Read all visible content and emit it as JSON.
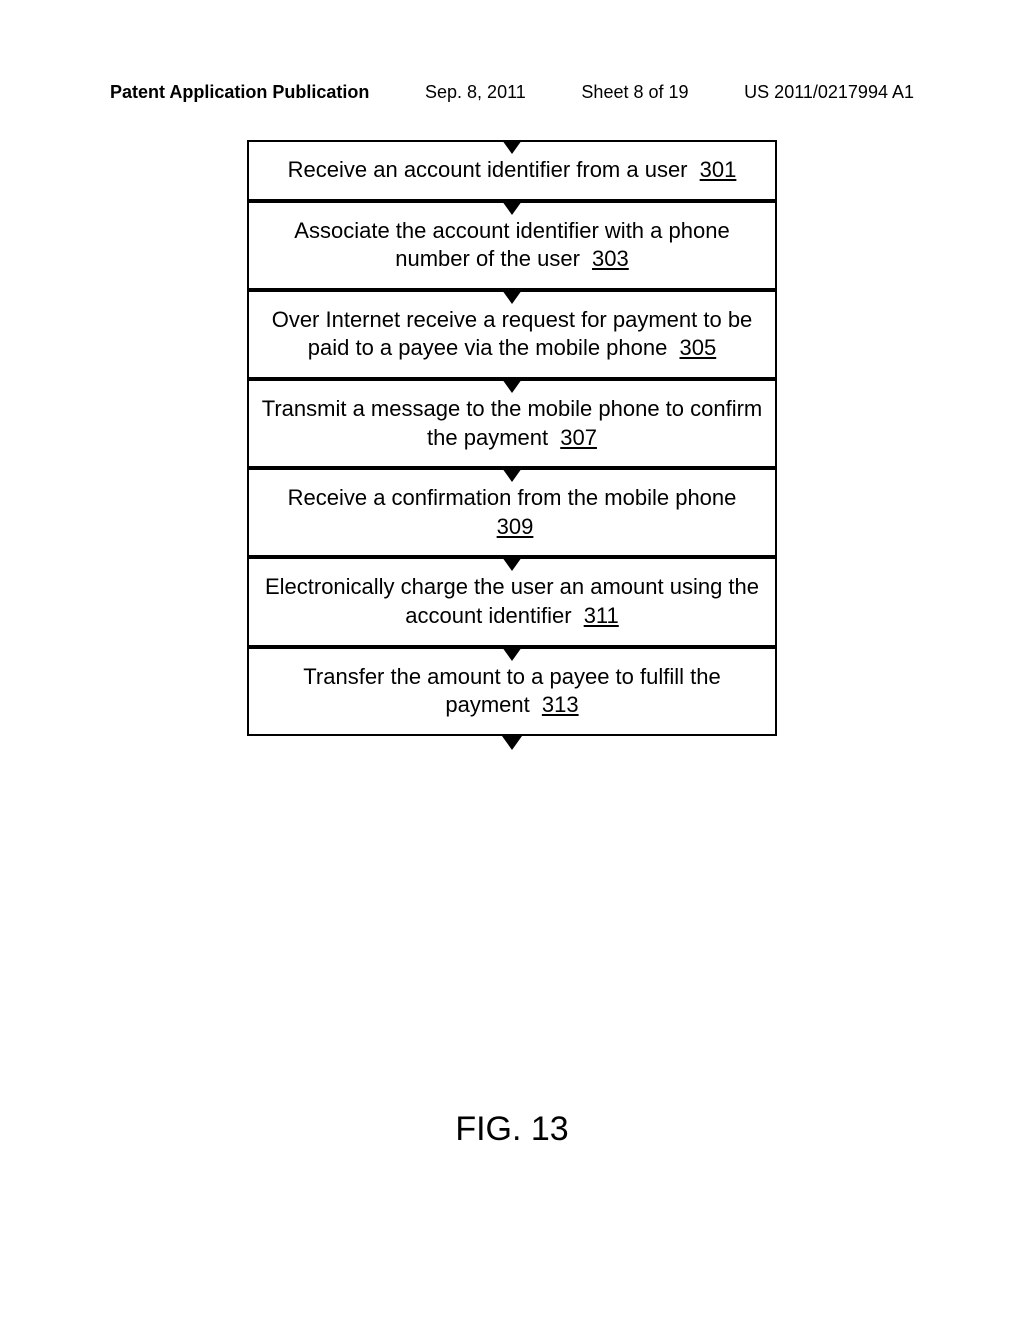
{
  "header": {
    "left": "Patent Application Publication",
    "date": "Sep. 8, 2011",
    "sheet": "Sheet 8 of 19",
    "pubno": "US 2011/0217994 A1"
  },
  "steps": [
    {
      "text": "Receive an account identifier from a user",
      "ref": "301"
    },
    {
      "text": "Associate the account identifier with a phone number of the user",
      "ref": "303"
    },
    {
      "text": "Over Internet receive a request for payment to be paid to a payee via the mobile phone",
      "ref": "305"
    },
    {
      "text": "Transmit a message to the mobile phone to confirm the payment",
      "ref": "307"
    },
    {
      "text": "Receive a confirmation from the mobile phone",
      "ref": "309"
    },
    {
      "text": "Electronically charge the user an amount using the account identifier",
      "ref": "311"
    },
    {
      "text": "Transfer the amount to a payee to fulfill the payment",
      "ref": "313"
    }
  ],
  "figure_label": "FIG. 13"
}
